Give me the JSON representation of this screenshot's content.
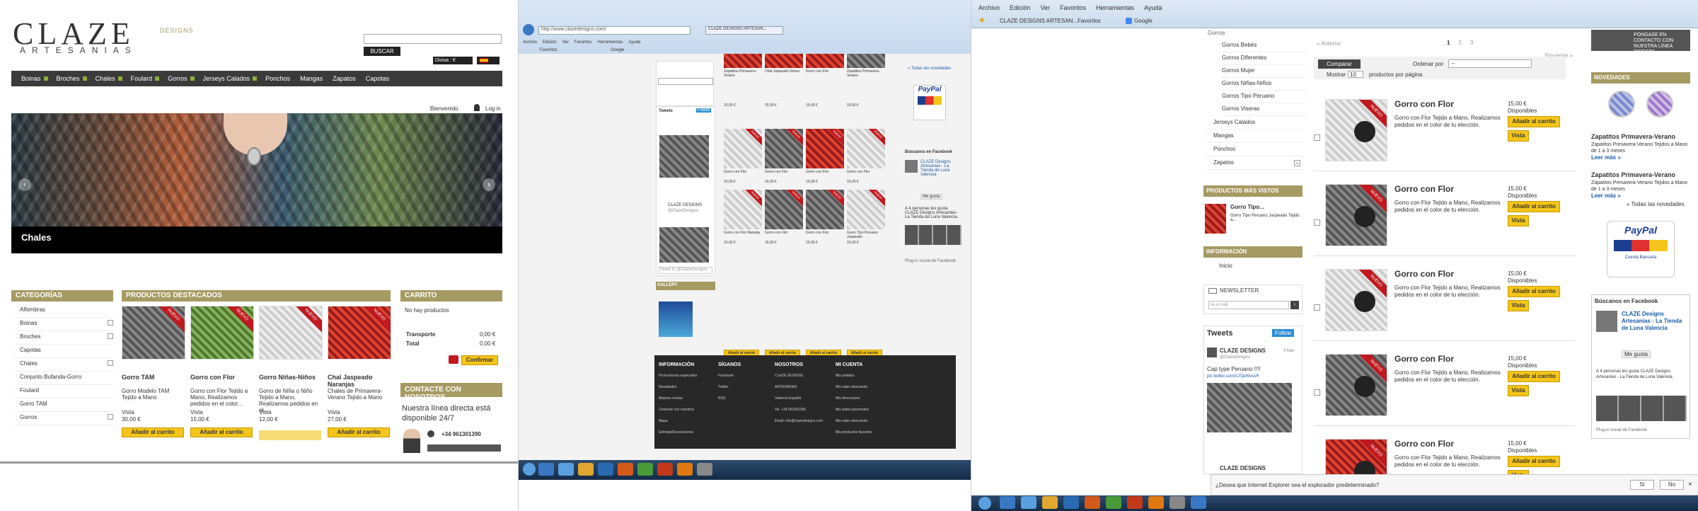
{
  "p1": {
    "logo": "CLAZE",
    "logo_sub": "ARTESANIAS",
    "logo_side": "DESIGNS",
    "search_btn": "BUSCAR",
    "divisa": "Divisa : €",
    "nav": [
      "Boinas",
      "Broches",
      "Chales",
      "Foulard",
      "Gorros",
      "Jerseys Calados",
      "Ponchos",
      "Mangas",
      "Zapatos",
      "Capotas"
    ],
    "welcome": "Bienvenido",
    "login": "Log in",
    "banner_caption": "Chales",
    "cat_title": "CATEGORÍAS",
    "cats": [
      "Alfombras",
      "Boinas",
      "Broches",
      "Capotas",
      "Chales",
      "Conjunto Bufanda-Gorro",
      "Foulard",
      "Gorro TAM",
      "Gorros"
    ],
    "feat_title": "PRODUCTOS DESTACADOS",
    "products": [
      {
        "name": "Gorro TAM",
        "desc": "Gorro Modelo TAM Tejido a Mano",
        "extra": "Vista",
        "price": "30,00 €"
      },
      {
        "name": "Gorro con Flor",
        "desc": "Gorro con Flor Tejido a Mano, Realizamos pedidos en el color...",
        "extra": "Vista",
        "price": "15,00 €"
      },
      {
        "name": "Gorro Niñas-Niños",
        "desc": "Gorro de Niña o Niño Tejido a Mano, Realizamos pedidos en el...",
        "extra": "Vista",
        "price": "12,00 €"
      },
      {
        "name": "Chal Jaspeado Naranjas",
        "desc": "Chales de Primavera-Verano Tejido a Mano",
        "extra": "Vista",
        "price": "27,00 €"
      }
    ],
    "ribbon": "NUEVO",
    "add_cart": "Añadir al carrito",
    "cart_title": "CARRITO",
    "cart_empty": "No hay productos",
    "transport": "Transporte",
    "transport_val": "0,00 €",
    "total": "Total",
    "total_val": "0,00 €",
    "confirm": "Confirmar",
    "contact_title": "CONTACTE CON NOSOTROS",
    "contact_text": "Nuestra línea directa está disponible 24/7",
    "phone": "+34 961301390"
  },
  "p2": {
    "url": "http://www.clazedesigns.com/",
    "tab": "CLAZE DESIGNS ARTESAN...",
    "menu": [
      "Archivo",
      "Edición",
      "Ver",
      "Favoritos",
      "Herramientas",
      "Ayuda"
    ],
    "fav": "Favoritos",
    "google": "Google",
    "all_news": "» Todas las novedades",
    "tweets": "Tweets",
    "follow": "Follow",
    "tw_user": "CLAZE DESIGNS",
    "tw_handle": "@ClazeDesigns",
    "tw_input": "Tweet to @ClazeDesigns",
    "gallery": "GALLERY",
    "fb_title": "Búscanos en Facebook",
    "fb_name": "CLAZE Designs Artesanias - La Tienda de Luna Valencia",
    "fb_like": "Me gusta",
    "fb_count": "A 4 personas les gusta CLAZE Designs Artesanias - La Tienda de Luna Valencia.",
    "fb_plugin": "Plug-in social de Facebook",
    "prod_names": [
      "Zapatitos Primavera-Verano",
      "Chal Jaspeado Grises",
      "Gorro con Flor",
      "Zapatitos Primavera-Verano",
      "Gorro con Flor",
      "Gorro con Flor",
      "Gorro con Flor",
      "Gorro con Flor",
      "Gorro con Flor Naranja",
      "Gorro con Flor",
      "Gorro con Flor",
      "Gorro Tipo Peruano Jaspeado"
    ],
    "small_price": "15,00 €",
    "add_cart": "Añadir al carrito",
    "footer_cols": [
      "INFORMACIÓN",
      "SÍGANOS",
      "NOSOTROS",
      "MI CUENTA"
    ],
    "footer_info": [
      "Promociones especiales",
      "Novedades",
      "Mejores ventas",
      "Contacte con nosotros",
      "Mapa",
      "Entrega/Devoluciones"
    ],
    "footer_follow": [
      "Facebook",
      "Twitter",
      "RSS"
    ],
    "footer_us": [
      "CLAZE DESIGNS",
      "ARTESANIAS",
      "Valencia España",
      "Tel. +34 961301390",
      "Email: info@clazedesigns.com"
    ],
    "footer_account": [
      "Mis pedidos",
      "Mis vales descuento",
      "Mis direcciones",
      "Mis datos personales",
      "Mis vales descuento",
      "Mis productos favoritos"
    ]
  },
  "p3": {
    "menu": [
      "Archivo",
      "Edición",
      "Ver",
      "Favoritos",
      "Herramientas",
      "Ayuda"
    ],
    "tab": "CLAZE DESIGNS ARTESAN...",
    "fav": "Favoritos",
    "google": "Google",
    "contact_banner": "PÓNGASE EN CONTACTO CON NUESTRA LÍNEA DIRECTA",
    "side_cats_top": "Gorros",
    "side_cats": [
      "Gorros Bebés",
      "Gorros Diferentes",
      "Gorros Mujer",
      "Gorros Niñas-Niños",
      "Gorros Tipo Peruano",
      "Gorros Viseras"
    ],
    "side_cats2": [
      "Jerseys Calados",
      "Mangas",
      "Ponchos",
      "Zapatos"
    ],
    "most_viewed": "PRODUCTOS MÁS VISTOS",
    "mv_name": "Gorro Tipo...",
    "mv_desc": "Gorro Tipo Peruano Jaspeado Tejido a...",
    "info_title": "INFORMACIÓN",
    "info_item": "Inicio",
    "newsletter": "NEWSLETTER",
    "newsletter_ph": "su e-mail",
    "tweets": "Tweets",
    "follow": "Follow",
    "tw_user": "CLAZE DESIGNS",
    "tw_handle": "@ClazeDesigns",
    "tw_date": "4 Mar",
    "tw_text": "Cap type Peruano !!!!",
    "tw_link": "pic.twitter.com/nJTjeWvusR",
    "prev": "« Anterior",
    "pages": [
      "1",
      "2",
      "3"
    ],
    "next": "Siguiente »",
    "compare": "Comparar",
    "order_by": "Ordenar por",
    "order_val": "--",
    "show": "Mostrar",
    "show_val": "10",
    "per_page": "productos por página",
    "items": [
      {
        "name": "Gorro con Flor",
        "desc": "Gorro con Flor Tejido a Mano, Realizamos pedidos en el color de tu elección.",
        "price": "15,00 €",
        "avail": "Disponibles"
      },
      {
        "name": "Gorro con Flor",
        "desc": "Gorro con Flor Tejido a Mano, Realizamos pedidos en el color de tu elección.",
        "price": "15,00 €",
        "avail": "Disponibles"
      },
      {
        "name": "Gorro con Flor",
        "desc": "Gorro con Flor Tejido a Mano, Realizamos pedidos en el color de tu elección.",
        "price": "15,00 €",
        "avail": "Disponibles"
      },
      {
        "name": "Gorro con Flor",
        "desc": "Gorro con Flor Tejido a Mano, Realizamos pedidos en el color de tu elección.",
        "price": "15,00 €",
        "avail": "Disponibles"
      },
      {
        "name": "Gorro con Flor",
        "desc": "Gorro con Flor Tejido a Mano, Realizamos pedidos en el color de tu elección.",
        "price": "15,00 €",
        "avail": "Disponibles"
      }
    ],
    "add_cart": "Añadir al carrito",
    "view": "Vista",
    "novedades": "NOVEDADES",
    "nov_items": [
      {
        "name": "Zapatitos Primavera-Verano",
        "desc": "Zapatitos Primavera-Verano Tejidos a Mano de 1 a 3 meses",
        "more": "Leer más »"
      },
      {
        "name": "Zapatitos Primavera-Verano",
        "desc": "Zapatitos Primavera-Verano Tejidos a Mano de 1 a 3 meses",
        "more": "Leer más »"
      }
    ],
    "all_news": "» Todas las novedades",
    "paypal": "PayPal",
    "paypal_sub": "Cuenta Bancaria",
    "fb_title": "Búscanos en Facebook",
    "fb_name": "CLAZE Designs Artesanias - La Tienda de Luna Valencia",
    "fb_like": "Me gusta",
    "fb_count": "A 4 personas les gusta CLAZE Designs Artesanias - La Tienda de Luna Valencia.",
    "fb_plugin": "Plug-in social de Facebook",
    "ie_prompt": "¿Desea que Internet Explorer sea el explorador predeterminado?",
    "yes": "Sí",
    "no": "No"
  },
  "colors": {
    "olive": "#a69a63",
    "yellow": "#f4c51a",
    "dark": "#3a3a3a",
    "red": "#c0191f",
    "blue": "#1a5aa6"
  }
}
